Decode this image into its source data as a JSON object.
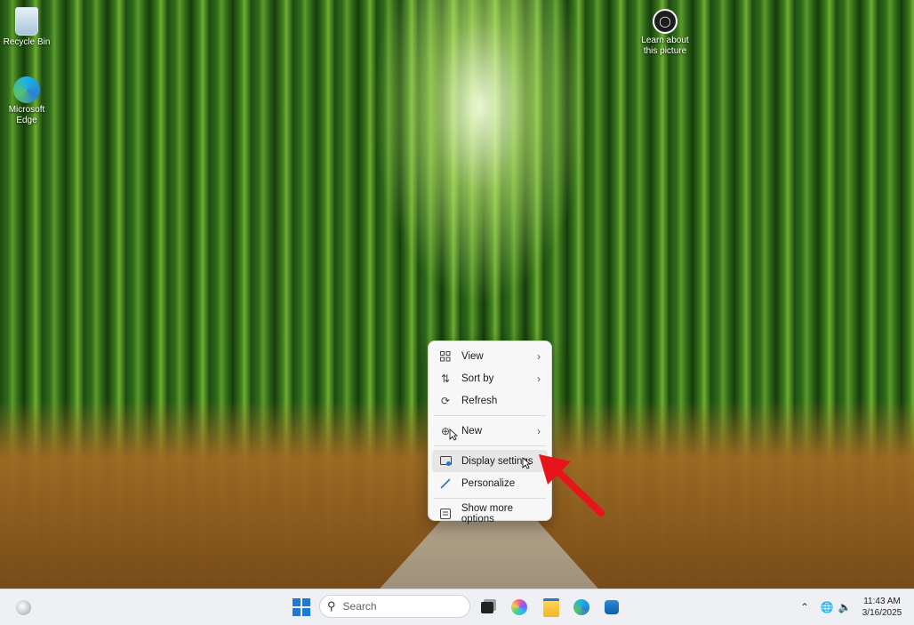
{
  "desktop": {
    "icons": [
      {
        "label": "Recycle Bin"
      },
      {
        "label": "Microsoft Edge"
      },
      {
        "label": "Learn about this picture"
      }
    ]
  },
  "context_menu": {
    "items": [
      {
        "label": "View",
        "icon": "view-grid-icon",
        "submenu": true
      },
      {
        "label": "Sort by",
        "icon": "sort-icon",
        "submenu": true
      },
      {
        "label": "Refresh",
        "icon": "refresh-icon",
        "submenu": false
      },
      {
        "label": "New",
        "icon": "new-plus-icon",
        "submenu": true
      },
      {
        "label": "Display settings",
        "icon": "display-settings-icon",
        "submenu": false,
        "highlighted": true
      },
      {
        "label": "Personalize",
        "icon": "brush-icon",
        "submenu": false
      },
      {
        "label": "Show more options",
        "icon": "more-options-icon",
        "submenu": false
      }
    ]
  },
  "annotation": {
    "arrow_color": "#e8141b"
  },
  "taskbar": {
    "search_placeholder": "Search",
    "time": "11:43 AM",
    "date": "3/16/2025",
    "accent": "#1f7ad6"
  }
}
